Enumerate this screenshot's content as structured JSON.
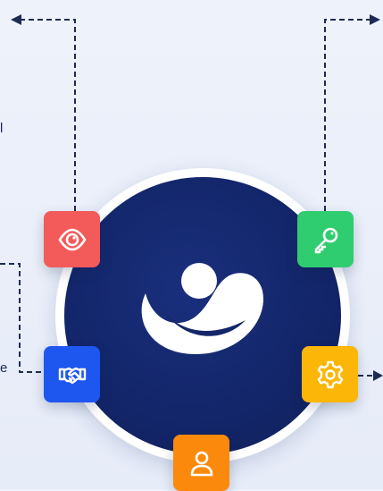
{
  "diagram": {
    "hub": {
      "logo_icon": "brand-swoosh-icon",
      "color": "#13266a"
    },
    "nodes": [
      {
        "id": "view",
        "icon": "eye-icon",
        "color": "#f35a5a"
      },
      {
        "id": "access",
        "icon": "key-icon",
        "color": "#2fcd6f"
      },
      {
        "id": "partner",
        "icon": "handshake-icon",
        "color": "#1e56f0"
      },
      {
        "id": "settings",
        "icon": "gear-icon",
        "color": "#fbb607"
      },
      {
        "id": "user",
        "icon": "user-icon",
        "color": "#fb8a0c"
      }
    ],
    "cropped_labels": [
      "l",
      "e"
    ],
    "connector_color": "#1d2b55"
  }
}
